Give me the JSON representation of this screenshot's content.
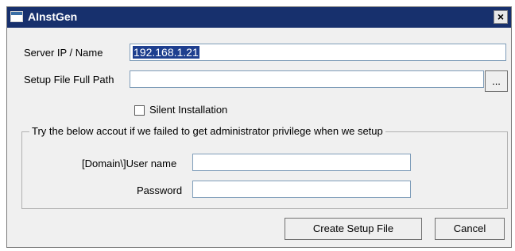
{
  "window": {
    "title": "AInstGen",
    "close_glyph": "×"
  },
  "form": {
    "server_label": "Server IP / Name",
    "server_value": "192.168.1.21",
    "setup_path_label": "Setup File Full Path",
    "setup_path_value": "",
    "browse_label": "...",
    "silent_label": "Silent Installation",
    "silent_checked": false
  },
  "group": {
    "title": "Try the below accout if we failed to get administrator privilege when we setup",
    "username_label": "[Domain\\]User name",
    "username_value": "",
    "password_label": "Password",
    "password_value": ""
  },
  "buttons": {
    "create_label": "Create Setup File",
    "cancel_label": "Cancel"
  },
  "icons": {
    "app_icon": "window-app-icon",
    "close_icon": "close-icon"
  }
}
